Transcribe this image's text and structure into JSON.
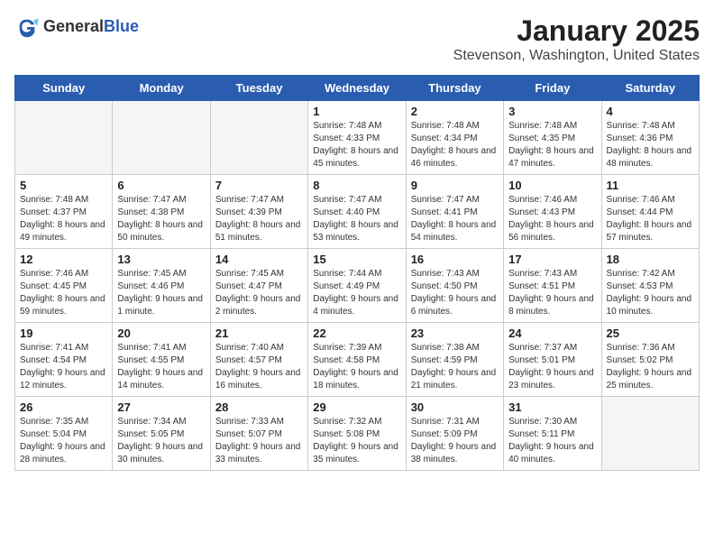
{
  "header": {
    "logo_general": "General",
    "logo_blue": "Blue",
    "month": "January 2025",
    "location": "Stevenson, Washington, United States"
  },
  "weekdays": [
    "Sunday",
    "Monday",
    "Tuesday",
    "Wednesday",
    "Thursday",
    "Friday",
    "Saturday"
  ],
  "weeks": [
    [
      {
        "day": "",
        "empty": true
      },
      {
        "day": "",
        "empty": true
      },
      {
        "day": "",
        "empty": true
      },
      {
        "day": "1",
        "sunrise": "7:48 AM",
        "sunset": "4:33 PM",
        "daylight": "8 hours and 45 minutes."
      },
      {
        "day": "2",
        "sunrise": "7:48 AM",
        "sunset": "4:34 PM",
        "daylight": "8 hours and 46 minutes."
      },
      {
        "day": "3",
        "sunrise": "7:48 AM",
        "sunset": "4:35 PM",
        "daylight": "8 hours and 47 minutes."
      },
      {
        "day": "4",
        "sunrise": "7:48 AM",
        "sunset": "4:36 PM",
        "daylight": "8 hours and 48 minutes."
      }
    ],
    [
      {
        "day": "5",
        "sunrise": "7:48 AM",
        "sunset": "4:37 PM",
        "daylight": "8 hours and 49 minutes."
      },
      {
        "day": "6",
        "sunrise": "7:47 AM",
        "sunset": "4:38 PM",
        "daylight": "8 hours and 50 minutes."
      },
      {
        "day": "7",
        "sunrise": "7:47 AM",
        "sunset": "4:39 PM",
        "daylight": "8 hours and 51 minutes."
      },
      {
        "day": "8",
        "sunrise": "7:47 AM",
        "sunset": "4:40 PM",
        "daylight": "8 hours and 53 minutes."
      },
      {
        "day": "9",
        "sunrise": "7:47 AM",
        "sunset": "4:41 PM",
        "daylight": "8 hours and 54 minutes."
      },
      {
        "day": "10",
        "sunrise": "7:46 AM",
        "sunset": "4:43 PM",
        "daylight": "8 hours and 56 minutes."
      },
      {
        "day": "11",
        "sunrise": "7:46 AM",
        "sunset": "4:44 PM",
        "daylight": "8 hours and 57 minutes."
      }
    ],
    [
      {
        "day": "12",
        "sunrise": "7:46 AM",
        "sunset": "4:45 PM",
        "daylight": "8 hours and 59 minutes."
      },
      {
        "day": "13",
        "sunrise": "7:45 AM",
        "sunset": "4:46 PM",
        "daylight": "9 hours and 1 minute."
      },
      {
        "day": "14",
        "sunrise": "7:45 AM",
        "sunset": "4:47 PM",
        "daylight": "9 hours and 2 minutes."
      },
      {
        "day": "15",
        "sunrise": "7:44 AM",
        "sunset": "4:49 PM",
        "daylight": "9 hours and 4 minutes."
      },
      {
        "day": "16",
        "sunrise": "7:43 AM",
        "sunset": "4:50 PM",
        "daylight": "9 hours and 6 minutes."
      },
      {
        "day": "17",
        "sunrise": "7:43 AM",
        "sunset": "4:51 PM",
        "daylight": "9 hours and 8 minutes."
      },
      {
        "day": "18",
        "sunrise": "7:42 AM",
        "sunset": "4:53 PM",
        "daylight": "9 hours and 10 minutes."
      }
    ],
    [
      {
        "day": "19",
        "sunrise": "7:41 AM",
        "sunset": "4:54 PM",
        "daylight": "9 hours and 12 minutes."
      },
      {
        "day": "20",
        "sunrise": "7:41 AM",
        "sunset": "4:55 PM",
        "daylight": "9 hours and 14 minutes."
      },
      {
        "day": "21",
        "sunrise": "7:40 AM",
        "sunset": "4:57 PM",
        "daylight": "9 hours and 16 minutes."
      },
      {
        "day": "22",
        "sunrise": "7:39 AM",
        "sunset": "4:58 PM",
        "daylight": "9 hours and 18 minutes."
      },
      {
        "day": "23",
        "sunrise": "7:38 AM",
        "sunset": "4:59 PM",
        "daylight": "9 hours and 21 minutes."
      },
      {
        "day": "24",
        "sunrise": "7:37 AM",
        "sunset": "5:01 PM",
        "daylight": "9 hours and 23 minutes."
      },
      {
        "day": "25",
        "sunrise": "7:36 AM",
        "sunset": "5:02 PM",
        "daylight": "9 hours and 25 minutes."
      }
    ],
    [
      {
        "day": "26",
        "sunrise": "7:35 AM",
        "sunset": "5:04 PM",
        "daylight": "9 hours and 28 minutes."
      },
      {
        "day": "27",
        "sunrise": "7:34 AM",
        "sunset": "5:05 PM",
        "daylight": "9 hours and 30 minutes."
      },
      {
        "day": "28",
        "sunrise": "7:33 AM",
        "sunset": "5:07 PM",
        "daylight": "9 hours and 33 minutes."
      },
      {
        "day": "29",
        "sunrise": "7:32 AM",
        "sunset": "5:08 PM",
        "daylight": "9 hours and 35 minutes."
      },
      {
        "day": "30",
        "sunrise": "7:31 AM",
        "sunset": "5:09 PM",
        "daylight": "9 hours and 38 minutes."
      },
      {
        "day": "31",
        "sunrise": "7:30 AM",
        "sunset": "5:11 PM",
        "daylight": "9 hours and 40 minutes."
      },
      {
        "day": "",
        "empty": true
      }
    ]
  ]
}
